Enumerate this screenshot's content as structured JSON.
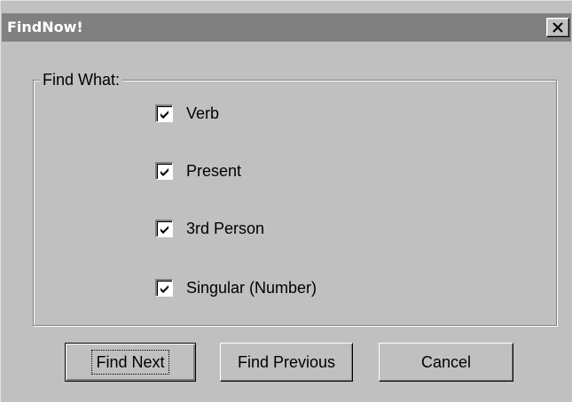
{
  "window": {
    "title": "FindNow!",
    "close_glyph": "×"
  },
  "group": {
    "legend": "Find What:",
    "options": [
      {
        "label": "Verb",
        "checked": true
      },
      {
        "label": "Present",
        "checked": true
      },
      {
        "label": "3rd Person",
        "checked": true
      },
      {
        "label": "Singular (Number)",
        "checked": true
      }
    ]
  },
  "buttons": {
    "find_next": "Find Next",
    "find_previous": "Find Previous",
    "cancel": "Cancel"
  },
  "colors": {
    "face": "#c0c0c0",
    "titlebar_inactive": "#808080",
    "title_text": "#ffffff"
  },
  "icons": {
    "close": "close-icon",
    "check": "checkmark-icon"
  }
}
